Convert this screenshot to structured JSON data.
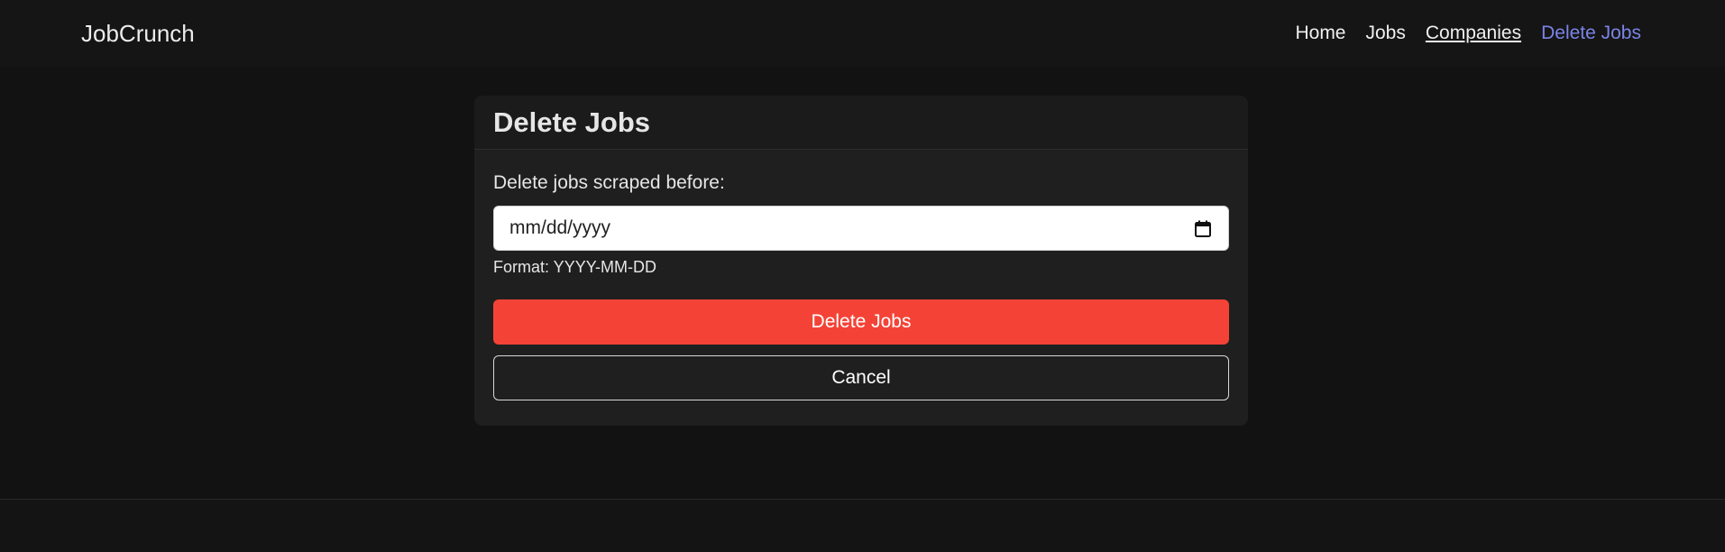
{
  "app": {
    "brand": "JobCrunch"
  },
  "nav": {
    "items": [
      {
        "label": "Home"
      },
      {
        "label": "Jobs"
      },
      {
        "label": "Companies"
      },
      {
        "label": "Delete Jobs"
      }
    ]
  },
  "card": {
    "title": "Delete Jobs",
    "field_label": "Delete jobs scraped before:",
    "date_placeholder": "mm/dd/yyyy",
    "help_text": "Format: YYYY-MM-DD",
    "delete_label": "Delete Jobs",
    "cancel_label": "Cancel"
  },
  "colors": {
    "background": "#121212",
    "active_link": "#7b84e8",
    "danger": "#f44336"
  },
  "icons": {
    "date_picker": "calendar-icon"
  }
}
